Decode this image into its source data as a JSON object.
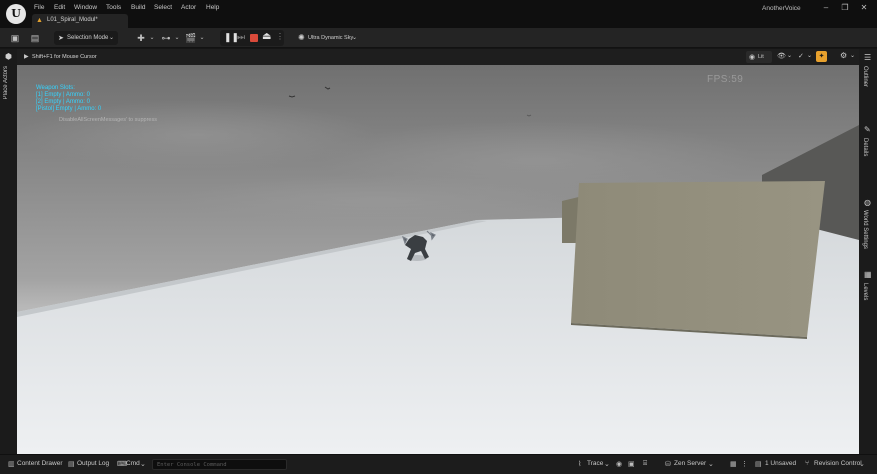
{
  "menu": [
    "File",
    "Edit",
    "Window",
    "Tools",
    "Build",
    "Select",
    "Actor",
    "Help"
  ],
  "level_tab": "L01_Spiral_Modul*",
  "project_name": "AnotherVoice",
  "window_controls": {
    "minimize": "–",
    "maximize": "❐",
    "close": "✕"
  },
  "toolbar": {
    "selection_mode": "Selection Mode",
    "sky": "Ultra Dynamic Sky"
  },
  "viewport": {
    "hint": "Shift+F1 for Mouse Cursor",
    "view_mode": "Lit",
    "fps": "FPS:59",
    "debug_lines": [
      "Weapon Slots:",
      "[1] Empty | Ammo: 0",
      "[2] Empty | Ammo: 0",
      "[Pistol] Empty | Ammo: 0"
    ],
    "suppress_hint": "DisableAllScreenMessages' to suppress"
  },
  "left_panel_label": "Place Actors",
  "right_panel_labels": [
    "Outliner",
    "Details",
    "World Settings",
    "Levels"
  ],
  "statusbar": {
    "content_drawer": "Content Drawer",
    "output_log": "Output Log",
    "cmd": "Cmd",
    "console_placeholder": "Enter Console Command",
    "trace": "Trace",
    "zen_server": "Zen Server",
    "unsaved": "1 Unsaved",
    "revision_control": "Revision Control"
  },
  "colors": {
    "debug_text": "#35d4ff",
    "stop_button": "#d94a3a",
    "accent_orange": "#e8a12d",
    "wall": "#8e8a78"
  }
}
